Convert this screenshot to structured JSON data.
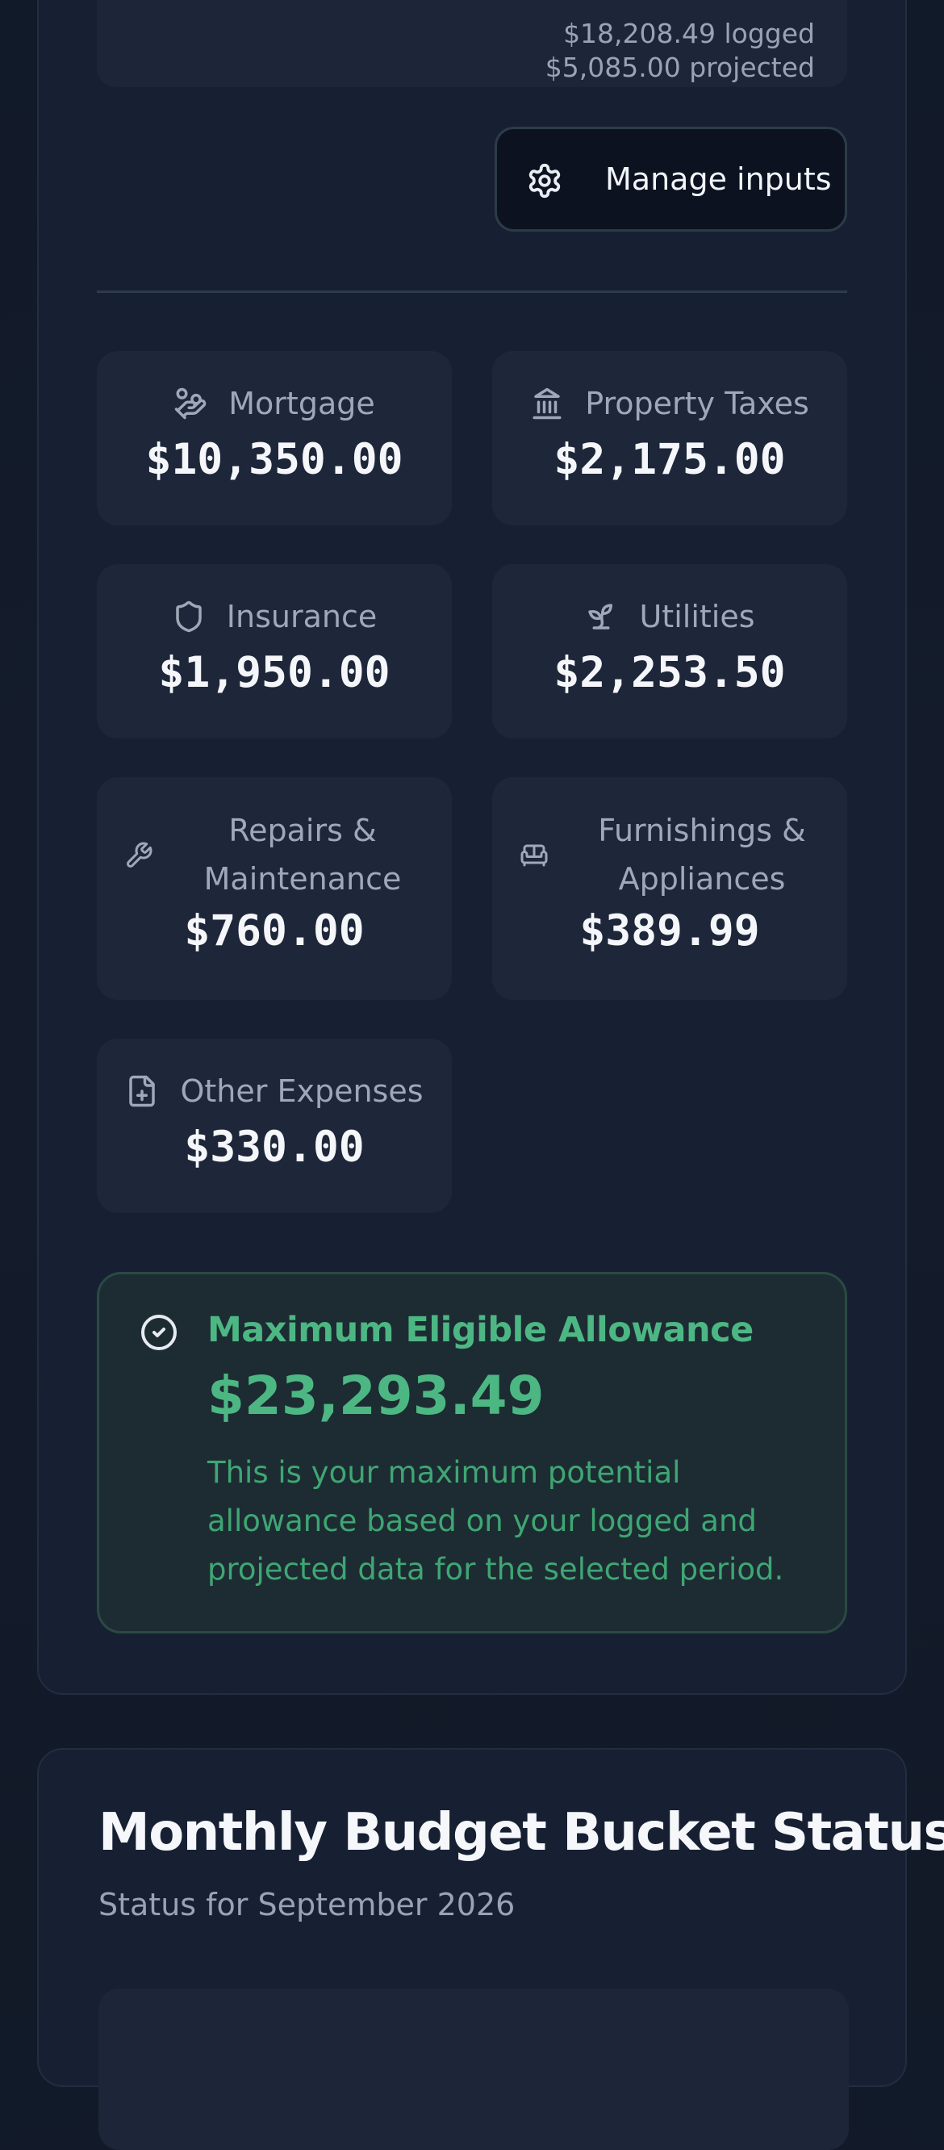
{
  "summary": {
    "logged_text": "$18,208.49 logged",
    "projected_text": "$5,085.00 projected",
    "manage_button_label": "Manage inputs",
    "manage_icon": "gear-icon"
  },
  "categories": [
    {
      "label": "Mortgage",
      "value": "$10,350.00",
      "icon": "hand-coins-icon"
    },
    {
      "label": "Property Taxes",
      "value": "$2,175.00",
      "icon": "landmark-icon"
    },
    {
      "label": "Insurance",
      "value": "$1,950.00",
      "icon": "shield-icon"
    },
    {
      "label": "Utilities",
      "value": "$2,253.50",
      "icon": "sprout-icon"
    },
    {
      "label": "Repairs & Maintenance",
      "value": "$760.00",
      "icon": "wrench-icon"
    },
    {
      "label": "Furnishings & Appliances",
      "value": "$389.99",
      "icon": "sofa-icon"
    },
    {
      "label": "Other Expenses",
      "value": "$330.00",
      "icon": "file-plus-icon"
    }
  ],
  "allowance": {
    "title": "Maximum Eligible Allowance",
    "amount": "$23,293.49",
    "description": "This is your maximum potential allowance based on your logged and projected data for the selected period.",
    "icon": "check-circle-icon",
    "accent_color": "#4db784"
  },
  "budget": {
    "title": "Monthly Budget Bucket Status",
    "subtitle": "Status for September 2026"
  }
}
